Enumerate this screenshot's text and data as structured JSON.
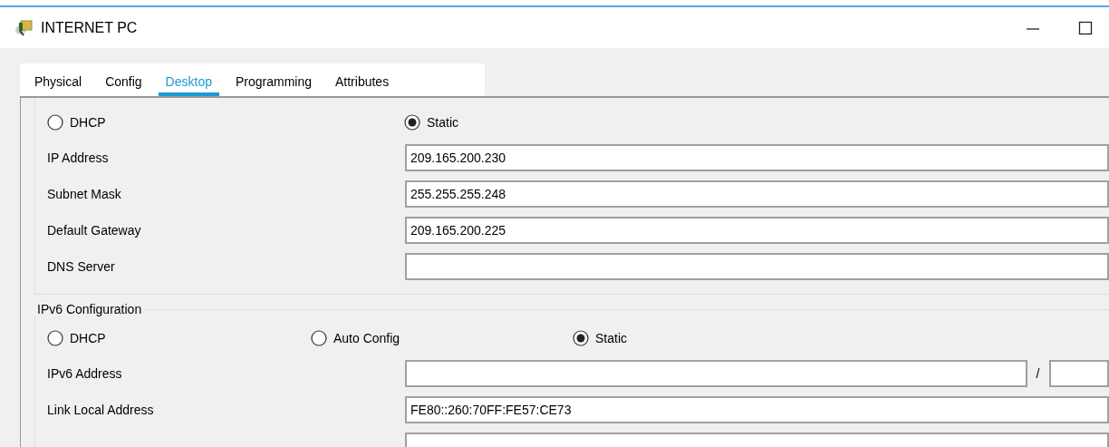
{
  "window": {
    "title": "INTERNET PC"
  },
  "tabs": [
    {
      "label": "Physical",
      "selected": false
    },
    {
      "label": "Config",
      "selected": false
    },
    {
      "label": "Desktop",
      "selected": true
    },
    {
      "label": "Programming",
      "selected": false
    },
    {
      "label": "Attributes",
      "selected": false
    }
  ],
  "ipv4": {
    "modes": [
      {
        "label": "DHCP",
        "selected": false
      },
      {
        "label": "Static",
        "selected": true
      }
    ],
    "fields": [
      {
        "label": "IP Address",
        "value": "209.165.200.230"
      },
      {
        "label": "Subnet Mask",
        "value": "255.255.255.248"
      },
      {
        "label": "Default Gateway",
        "value": "209.165.200.225"
      },
      {
        "label": "DNS Server"
      }
    ]
  },
  "ipv6": {
    "title": "IPv6 Configuration",
    "modes": [
      {
        "label": "DHCP",
        "selected": false
      },
      {
        "label": "Auto Config",
        "selected": false
      },
      {
        "label": "Static",
        "selected": true
      }
    ],
    "fields": [
      {
        "label": "IPv6 Address",
        "kind": "prefix",
        "separator": "/"
      },
      {
        "label": "Link Local Address",
        "value": "FE80::260:70FF:FE57:CE73"
      },
      {
        "kind": "plain"
      }
    ]
  }
}
